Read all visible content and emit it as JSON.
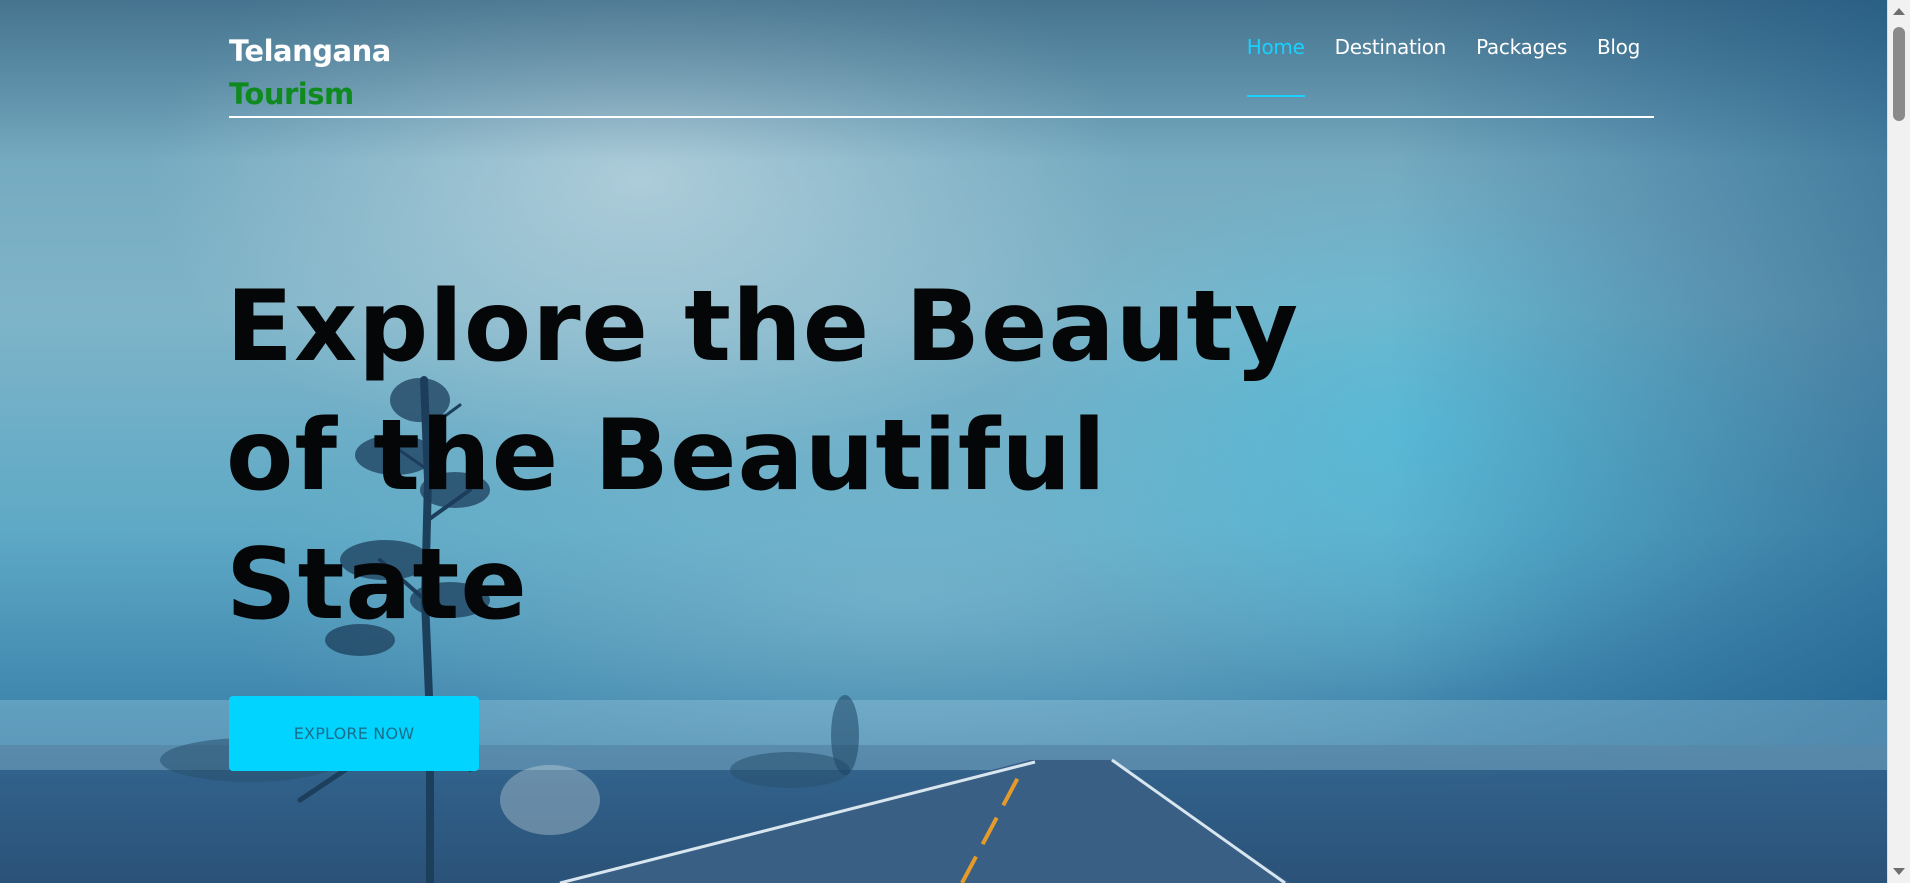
{
  "brand": {
    "line1": "Telangana",
    "line2": "Tourism",
    "line2_color": "#0e8a1f"
  },
  "nav": {
    "items": [
      {
        "label": "Home",
        "active": true
      },
      {
        "label": "Destination",
        "active": false
      },
      {
        "label": "Packages",
        "active": false
      },
      {
        "label": "Blog",
        "active": false
      }
    ],
    "active_color": "#19d0ff"
  },
  "hero": {
    "title_lines": [
      "Explore the Beauty",
      "of the Beautiful",
      "State"
    ],
    "cta_label": "EXPLORE NOW",
    "cta_color": "#00d4ff"
  },
  "background": {
    "description_icon": "foggy-road-landscape-image"
  }
}
